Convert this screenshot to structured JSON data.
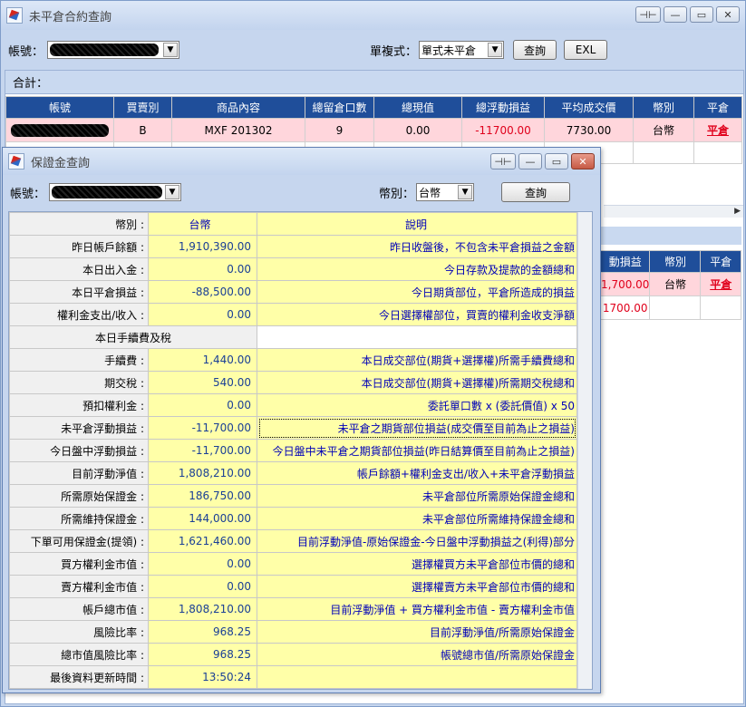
{
  "main_window": {
    "title": "未平倉合約查詢",
    "account_label": "帳號：",
    "mode_label": "單複式：",
    "mode_value": "單式未平倉",
    "query_button": "查詢",
    "excel_button": "EXL",
    "summary_label": "合計：",
    "columns": [
      "帳號",
      "買賣別",
      "商品內容",
      "總留倉口數",
      "總現值",
      "總浮動損益",
      "平均成交價",
      "幣別",
      "平倉"
    ],
    "rows": [
      {
        "side": "B",
        "product": "MXF 201302",
        "lots": "9",
        "present_value": "0.00",
        "float_pl": "-11700.00",
        "avg_price": "7730.00",
        "currency": "台幣",
        "action": "平倉"
      }
    ],
    "sub_columns": [
      "動損益",
      "幣別",
      "平倉"
    ],
    "sub_rows": [
      {
        "pl": "1,700.00",
        "currency": "台幣",
        "action": "平倉"
      },
      {
        "pl": "1700.00",
        "currency": "",
        "action": ""
      }
    ]
  },
  "margin_window": {
    "title": "保證金查詢",
    "account_label": "帳號：",
    "currency_label": "幣別：",
    "currency_value": "台幣",
    "query_button": "查詢",
    "header": {
      "label": "幣別 :",
      "value": "台幣",
      "desc": "說明"
    },
    "rows_a": [
      {
        "label": "昨日帳戶餘額 :",
        "value": "1,910,390.00",
        "desc": "昨日收盤後，不包含未平倉損益之金額"
      },
      {
        "label": "本日出入金 :",
        "value": "0.00",
        "desc": "今日存款及提款的金額總和"
      },
      {
        "label": "本日平倉損益 :",
        "value": "-88,500.00",
        "desc": "今日期貨部位，平倉所造成的損益"
      },
      {
        "label": "權利金支出/收入 :",
        "value": "0.00",
        "desc": "今日選擇權部位，買賣的權利金收支淨額"
      }
    ],
    "section_title": "本日手續費及稅",
    "rows_b": [
      {
        "label": "手續費 :",
        "value": "1,440.00",
        "desc": "本日成交部位(期貨+選擇權)所需手續費總和"
      },
      {
        "label": "期交稅 :",
        "value": "540.00",
        "desc": "本日成交部位(期貨+選擇權)所需期交稅總和"
      },
      {
        "label": "預扣權利金 :",
        "value": "0.00",
        "desc": "委託單口數 x (委託價值) x 50"
      },
      {
        "label": "未平倉浮動損益 :",
        "value": "-11,700.00",
        "desc": "未平倉之期貨部位損益(成交價至目前為止之損益)"
      },
      {
        "label": "今日盤中浮動損益 :",
        "value": "-11,700.00",
        "desc": "今日盤中未平倉之期貨部位損益(昨日結算價至目前為止之損益)"
      },
      {
        "label": "目前浮動淨值 :",
        "value": "1,808,210.00",
        "desc": "帳戶餘額+權利金支出/收入+未平倉浮動損益"
      },
      {
        "label": "所需原始保證金 :",
        "value": "186,750.00",
        "desc": "未平倉部位所需原始保證金總和"
      },
      {
        "label": "所需維持保證金 :",
        "value": "144,000.00",
        "desc": "未平倉部位所需維持保證金總和"
      },
      {
        "label": "下單可用保證金(提領) :",
        "value": "1,621,460.00",
        "desc": "目前浮動淨值-原始保證金-今日盤中浮動損益之(利得)部分"
      },
      {
        "label": "買方權利金市值 :",
        "value": "0.00",
        "desc": "選擇權買方未平倉部位市價的總和"
      },
      {
        "label": "賣方權利金市值 :",
        "value": "0.00",
        "desc": "選擇權賣方未平倉部位市價的總和"
      },
      {
        "label": "帳戶總市值 :",
        "value": "1,808,210.00",
        "desc": "目前浮動淨值 + 買方權利金市值 - 賣方權利金市值"
      },
      {
        "label": "風險比率 :",
        "value": "968.25",
        "desc": "目前浮動淨值/所需原始保證金"
      },
      {
        "label": "總市值風險比率 :",
        "value": "968.25",
        "desc": "帳號總市值/所需原始保證金"
      },
      {
        "label": "最後資料更新時間 :",
        "value": "13:50:24",
        "desc": ""
      }
    ]
  }
}
